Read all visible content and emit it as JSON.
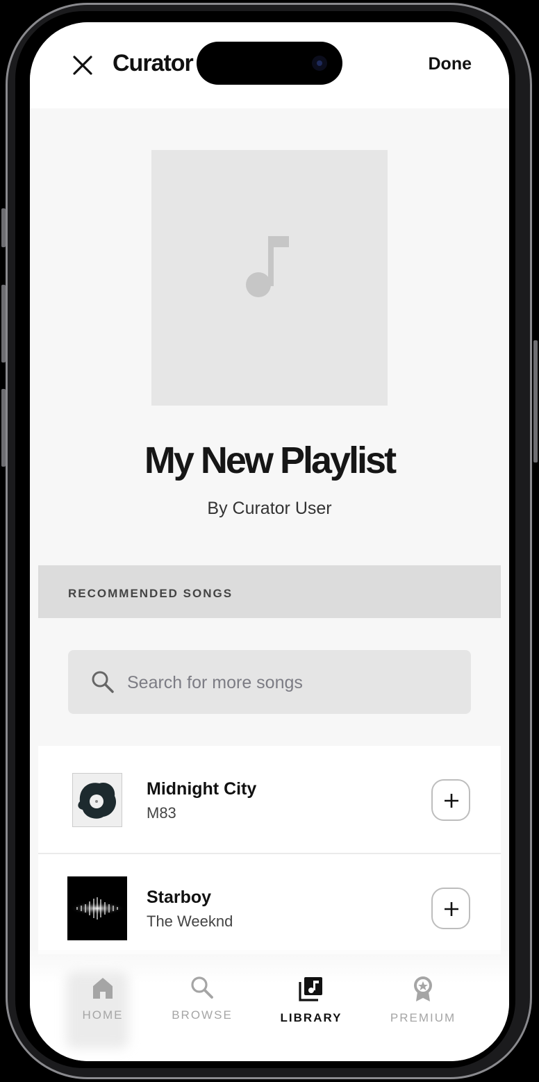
{
  "header": {
    "app_title": "Curator",
    "done_label": "Done",
    "close_icon": "close-icon"
  },
  "playlist": {
    "title": "My New Playlist",
    "owner": "By Curator User",
    "cover_icon": "music-note-icon"
  },
  "recommended": {
    "section_label": "RECOMMENDED SONGS",
    "search_placeholder": "Search for more songs",
    "songs": [
      {
        "title": "Midnight City",
        "artist": "M83"
      },
      {
        "title": "Starboy",
        "artist": "The Weeknd"
      }
    ]
  },
  "tabbar": {
    "tabs": [
      {
        "label": "HOME",
        "icon": "home-icon"
      },
      {
        "label": "BROWSE",
        "icon": "search-icon"
      },
      {
        "label": "LIBRARY",
        "icon": "library-icon",
        "active": true
      },
      {
        "label": "PREMIUM",
        "icon": "premium-badge-icon"
      }
    ]
  },
  "colors": {
    "background": "#f7f7f7",
    "section_header": "#dcdcdc",
    "text_primary": "#111111",
    "tab_inactive": "#a5a5a5"
  }
}
